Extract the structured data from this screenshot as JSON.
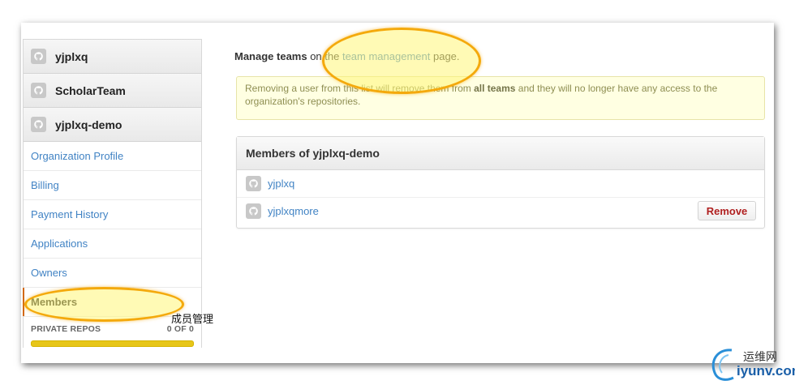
{
  "sidebar": {
    "orgs": [
      {
        "name": "yjplxq"
      },
      {
        "name": "ScholarTeam"
      },
      {
        "name": "yjplxq-demo"
      }
    ],
    "nav": [
      {
        "label": "Organization Profile"
      },
      {
        "label": "Billing"
      },
      {
        "label": "Payment History"
      },
      {
        "label": "Applications"
      },
      {
        "label": "Owners"
      },
      {
        "label": "Members",
        "active": true
      }
    ],
    "repos": {
      "label": "PRIVATE REPOS",
      "count": "0 OF 0",
      "usage_fraction": 0.0
    }
  },
  "annotation": {
    "caption": "成员管理"
  },
  "main": {
    "intro": {
      "prefix": "Manage teams",
      "on": " on the ",
      "link": "team management",
      "suffix": " page."
    },
    "warning": {
      "part1": "Removing a user from this list will remove them from ",
      "bold": "all teams",
      "part2": " and they will no longer have any access to the organization's repositories."
    },
    "members_box": {
      "title": "Members of yjplxq-demo",
      "members": [
        {
          "name": "yjplxq",
          "removable": false
        },
        {
          "name": "yjplxqmore",
          "removable": true,
          "action": "Remove"
        }
      ]
    }
  },
  "watermark": {
    "line1": "运维网",
    "line2": "iyunv.com"
  },
  "colors": {
    "link": "#4183c4",
    "active_indicator": "#d26911",
    "highlight_border": "#f4a90c",
    "warning_bg": "#ffffe2",
    "remove_text": "#b02020",
    "repos_bar": "#e7c619"
  },
  "icons": {
    "avatar": "octocat-avatar-icon"
  }
}
